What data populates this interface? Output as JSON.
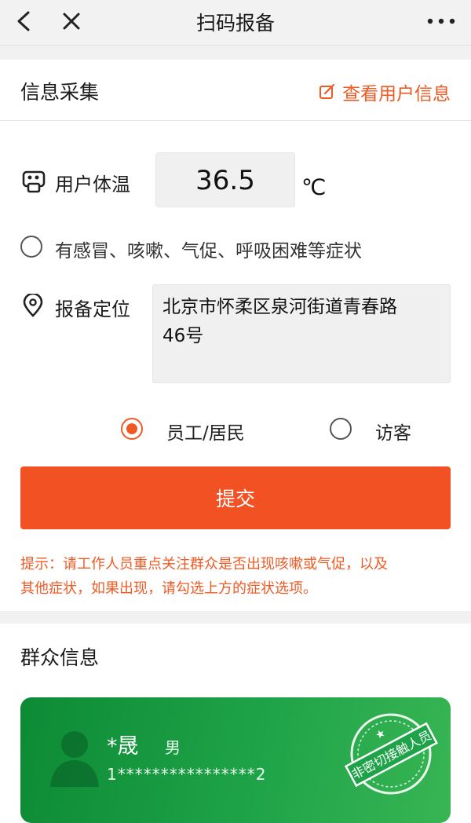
{
  "nav": {
    "title": "扫码报备",
    "back_icon": "chevron-left-icon",
    "close_icon": "close-icon",
    "more_icon": "more-dots-icon"
  },
  "info": {
    "section_title": "信息采集",
    "view_user_link": "查看用户信息"
  },
  "form": {
    "temperature_label": "用户体温",
    "temperature_value": "36.5",
    "temperature_unit": "℃",
    "symptom_option": "有感冒、咳嗽、气促、呼吸困难等症状",
    "location_label": "报备定位",
    "location_line1": "北京市怀柔区泉河街道青春路",
    "location_line2": "46号",
    "role_options": [
      "员工/居民",
      "访客"
    ],
    "role_selected": "员工/居民",
    "submit_label": "提交"
  },
  "tip": {
    "line1": "提示：请工作人员重点关注群众是否出现咳嗽或气促，以及",
    "line2": "其他症状，如果出现，请勾选上方的症状选项。"
  },
  "crowd": {
    "section_title": "群众信息",
    "card": {
      "name": "*晟",
      "gender": "男",
      "id_number": "1****************2",
      "stamp_text": "非密切接触人员"
    }
  },
  "colors": {
    "accent": "#f25124",
    "card_green": "#1a9a44"
  }
}
